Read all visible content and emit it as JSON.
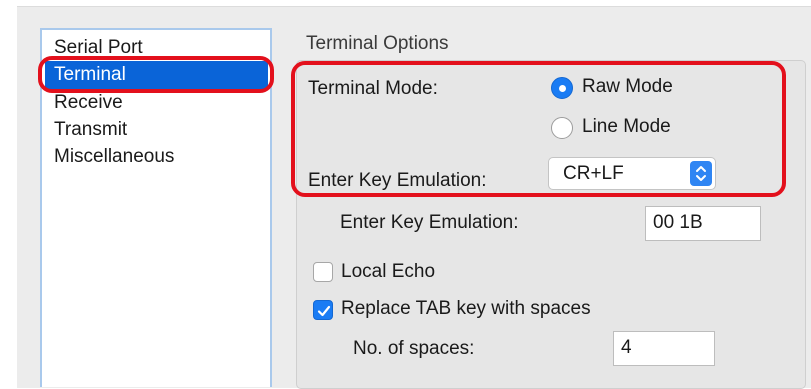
{
  "sidebar": {
    "items": [
      {
        "label": "Serial Port"
      },
      {
        "label": "Terminal",
        "selected": true
      },
      {
        "label": "Receive"
      },
      {
        "label": "Transmit"
      },
      {
        "label": "Miscellaneous"
      }
    ]
  },
  "terminal_options": {
    "title": "Terminal Options",
    "terminal_mode_label": "Terminal Mode:",
    "raw_mode_label": "Raw Mode",
    "line_mode_label": "Line Mode",
    "selected_mode": "Raw Mode",
    "enter_key_emulation_label": "Enter Key Emulation:",
    "enter_key_emulation_value": "CR+LF",
    "enter_key_emulation_hex_label": "Enter Key Emulation:",
    "enter_key_emulation_hex_value": "00 1B",
    "local_echo_label": "Local Echo",
    "local_echo_checked": false,
    "replace_tab_label": "Replace TAB key with spaces",
    "replace_tab_checked": true,
    "num_spaces_label": "No. of spaces:",
    "num_spaces_value": "4"
  },
  "colors": {
    "selection": "#0a64d8",
    "accent": "#1a7cf4",
    "highlight_annotation": "#e3101c"
  },
  "icons": {
    "radio_selected": "radio-selected-icon",
    "popup_arrows": "chevron-up-down-icon",
    "checkmark": "checkmark-icon"
  }
}
